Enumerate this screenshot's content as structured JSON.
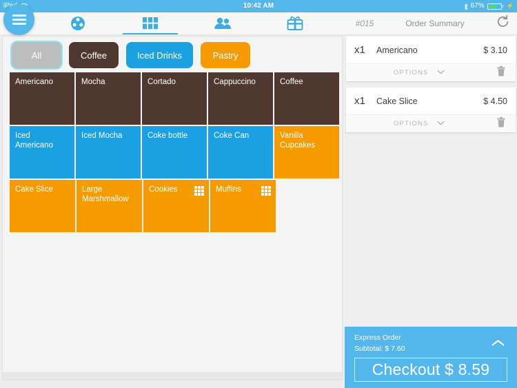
{
  "statusbar": {
    "device": "iPad",
    "wifi_icon": "wifi-icon",
    "time": "10:42 AM",
    "bluetooth_icon": "bluetooth-icon",
    "battery_percent": "67%",
    "battery_icon": "battery-icon",
    "battery_level": 67,
    "charging_icon": "lightning-icon"
  },
  "navbar": {
    "menu_icon": "hamburger-menu-icon",
    "items": [
      {
        "icon": "tables-floorplan-icon",
        "active": false
      },
      {
        "icon": "products-grid-icon",
        "active": true
      },
      {
        "icon": "customers-people-icon",
        "active": false
      },
      {
        "icon": "gift-card-icon",
        "active": false
      }
    ],
    "order_number": "#015",
    "order_title": "Order Summary",
    "refresh_icon": "refresh-icon"
  },
  "categories": [
    {
      "label": "All",
      "color": "#bdbdbd",
      "selected": true
    },
    {
      "label": "Coffee",
      "color": "#4f382f",
      "selected": false
    },
    {
      "label": "Iced Drinks",
      "color": "#1ba1e2",
      "selected": false
    },
    {
      "label": "Pastry",
      "color": "#f59b00",
      "selected": false
    }
  ],
  "products": {
    "rows": [
      [
        {
          "label": "Americano",
          "color": "#4f382f",
          "variants": false
        },
        {
          "label": "Mocha",
          "color": "#4f382f",
          "variants": false
        },
        {
          "label": "Cortado",
          "color": "#4f382f",
          "variants": false
        },
        {
          "label": "Cappuccino",
          "color": "#4f382f",
          "variants": false
        },
        {
          "label": "Coffee",
          "color": "#4f382f",
          "variants": false
        }
      ],
      [
        {
          "label": "Iced Americano",
          "color": "#1ba1e2",
          "variants": false
        },
        {
          "label": "Iced Mocha",
          "color": "#1ba1e2",
          "variants": false
        },
        {
          "label": "Coke bottle",
          "color": "#1ba1e2",
          "variants": false
        },
        {
          "label": "Coke Can",
          "color": "#1ba1e2",
          "variants": false
        },
        {
          "label": "Vanilla Cupcakes",
          "color": "#f59b00",
          "variants": false
        }
      ],
      [
        {
          "label": "Cake Slice",
          "color": "#f59b00",
          "variants": false
        },
        {
          "label": "Large Marshmallow",
          "color": "#f59b00",
          "variants": false
        },
        {
          "label": "Cookies",
          "color": "#f59b00",
          "variants": true
        },
        {
          "label": "Muffins",
          "color": "#f59b00",
          "variants": true
        }
      ]
    ],
    "variant_icon": "grid-variants-icon"
  },
  "order": {
    "items": [
      {
        "qty": "x1",
        "name": "Americano",
        "price": "$ 3.10",
        "options_label": "OPTIONS",
        "chevron_icon": "chevron-down-icon",
        "delete_icon": "trash-icon"
      },
      {
        "qty": "x1",
        "name": "Cake Slice",
        "price": "$ 4.50",
        "options_label": "OPTIONS",
        "chevron_icon": "chevron-down-icon",
        "delete_icon": "trash-icon"
      }
    ]
  },
  "checkout": {
    "express_label": "Express Order",
    "subtotal_label": "Subtotal: $ 7.60",
    "expand_icon": "chevron-up-icon",
    "button_label": "Checkout $ 8.59",
    "accent_color": "#53b7ec"
  }
}
